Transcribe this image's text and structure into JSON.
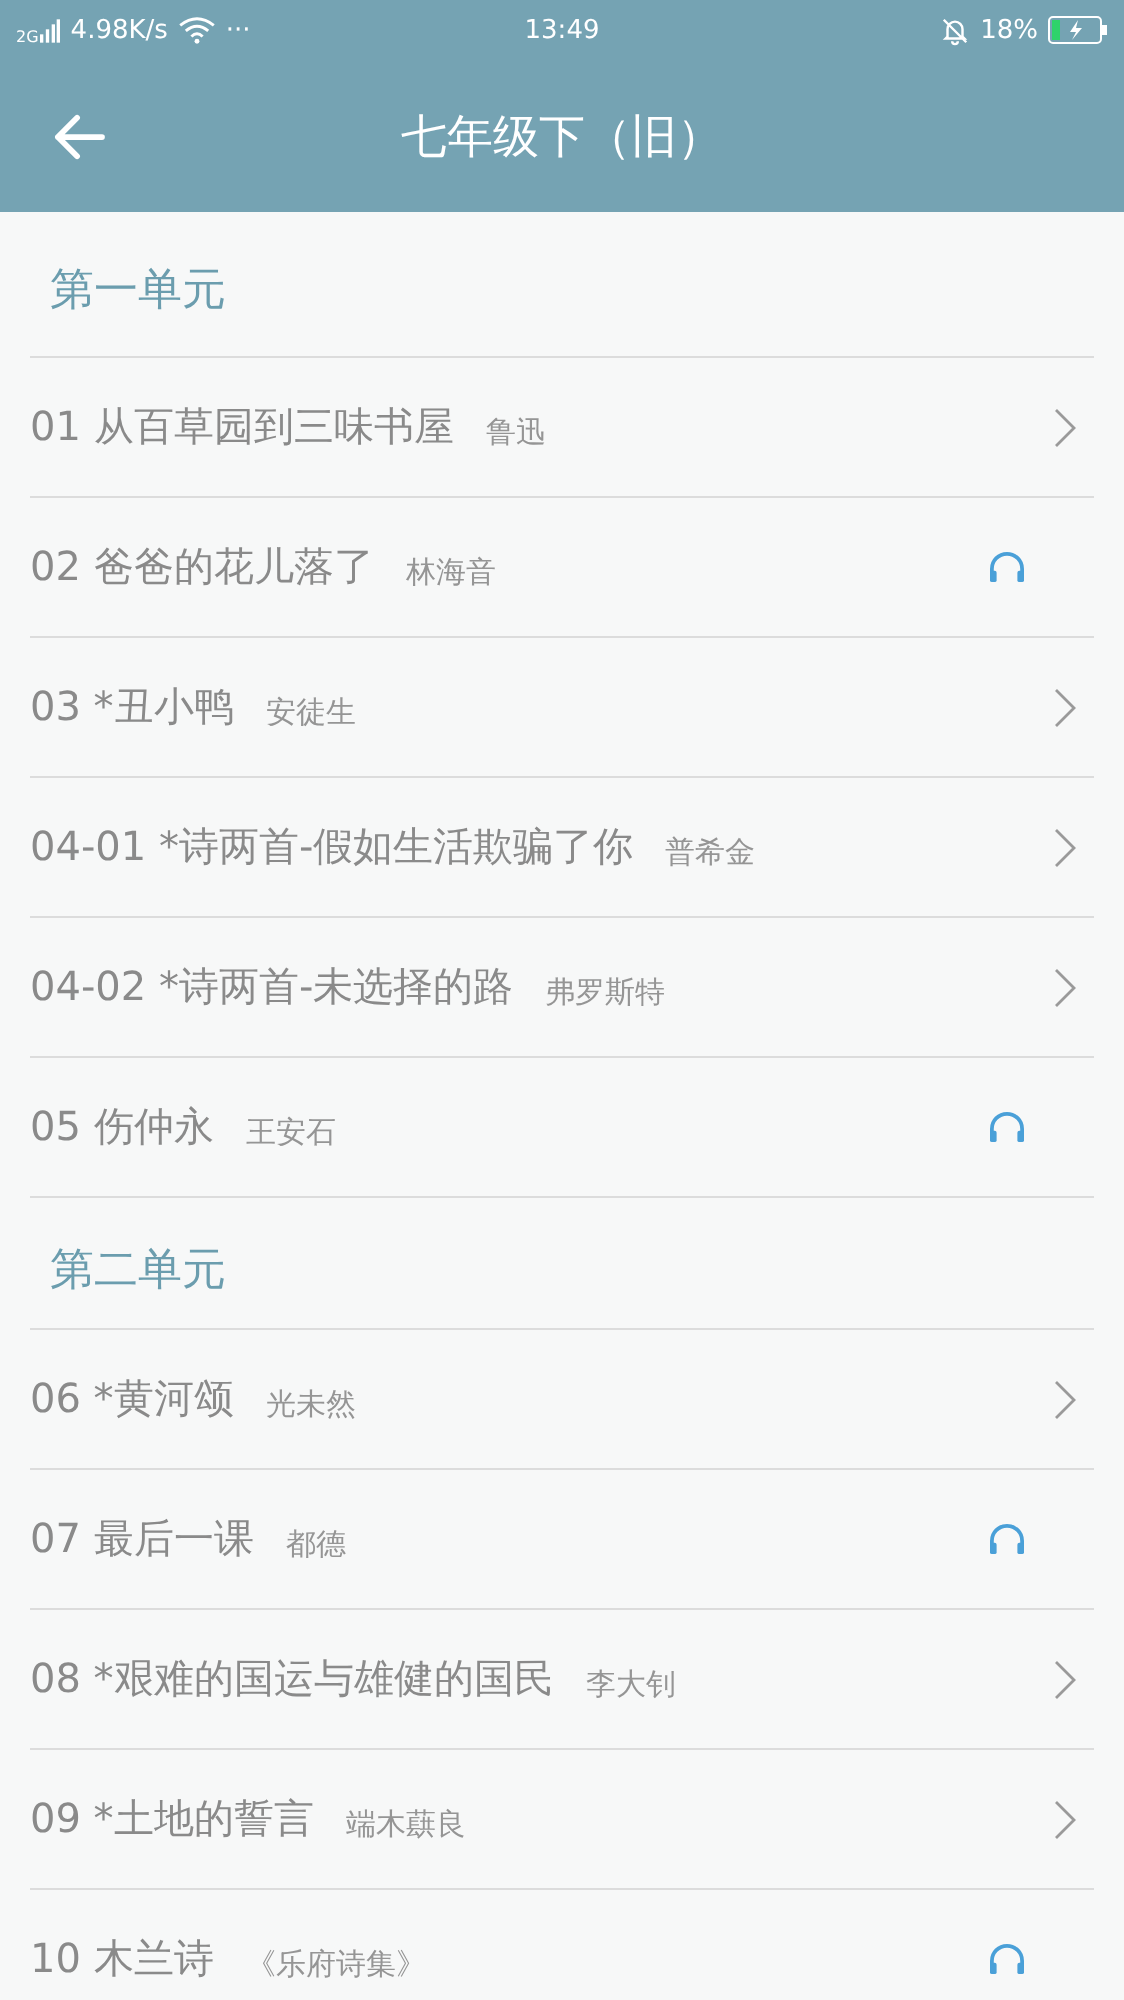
{
  "status_bar": {
    "network": "2G",
    "speed": "4.98K/s",
    "more": "···",
    "time": "13:49",
    "battery": "18%"
  },
  "header": {
    "title": "七年级下（旧）"
  },
  "sections": [
    {
      "title": "第一单元",
      "items": [
        {
          "number": "01",
          "title": "从百草园到三味书屋",
          "author": "鲁迅",
          "kind": "chevron"
        },
        {
          "number": "02",
          "title": "爸爸的花儿落了",
          "author": "林海音",
          "kind": "audio"
        },
        {
          "number": "03",
          "title": "*丑小鸭",
          "author": "安徒生",
          "kind": "chevron"
        },
        {
          "number": "04-01",
          "title": "*诗两首-假如生活欺骗了你",
          "author": "普希金",
          "kind": "chevron"
        },
        {
          "number": "04-02",
          "title": "*诗两首-未选择的路",
          "author": "弗罗斯特",
          "kind": "chevron"
        },
        {
          "number": "05",
          "title": "伤仲永",
          "author": "王安石",
          "kind": "audio"
        }
      ]
    },
    {
      "title": "第二单元",
      "items": [
        {
          "number": "06",
          "title": "*黄河颂",
          "author": "光未然",
          "kind": "chevron"
        },
        {
          "number": "07",
          "title": "最后一课",
          "author": "都德",
          "kind": "audio"
        },
        {
          "number": "08",
          "title": "*艰难的国运与雄健的国民",
          "author": "李大钊",
          "kind": "chevron"
        },
        {
          "number": "09",
          "title": "*土地的誓言",
          "author": "端木蕻良",
          "kind": "chevron"
        },
        {
          "number": "10",
          "title": "木兰诗",
          "author": "《乐府诗集》",
          "kind": "audio"
        }
      ]
    }
  ]
}
